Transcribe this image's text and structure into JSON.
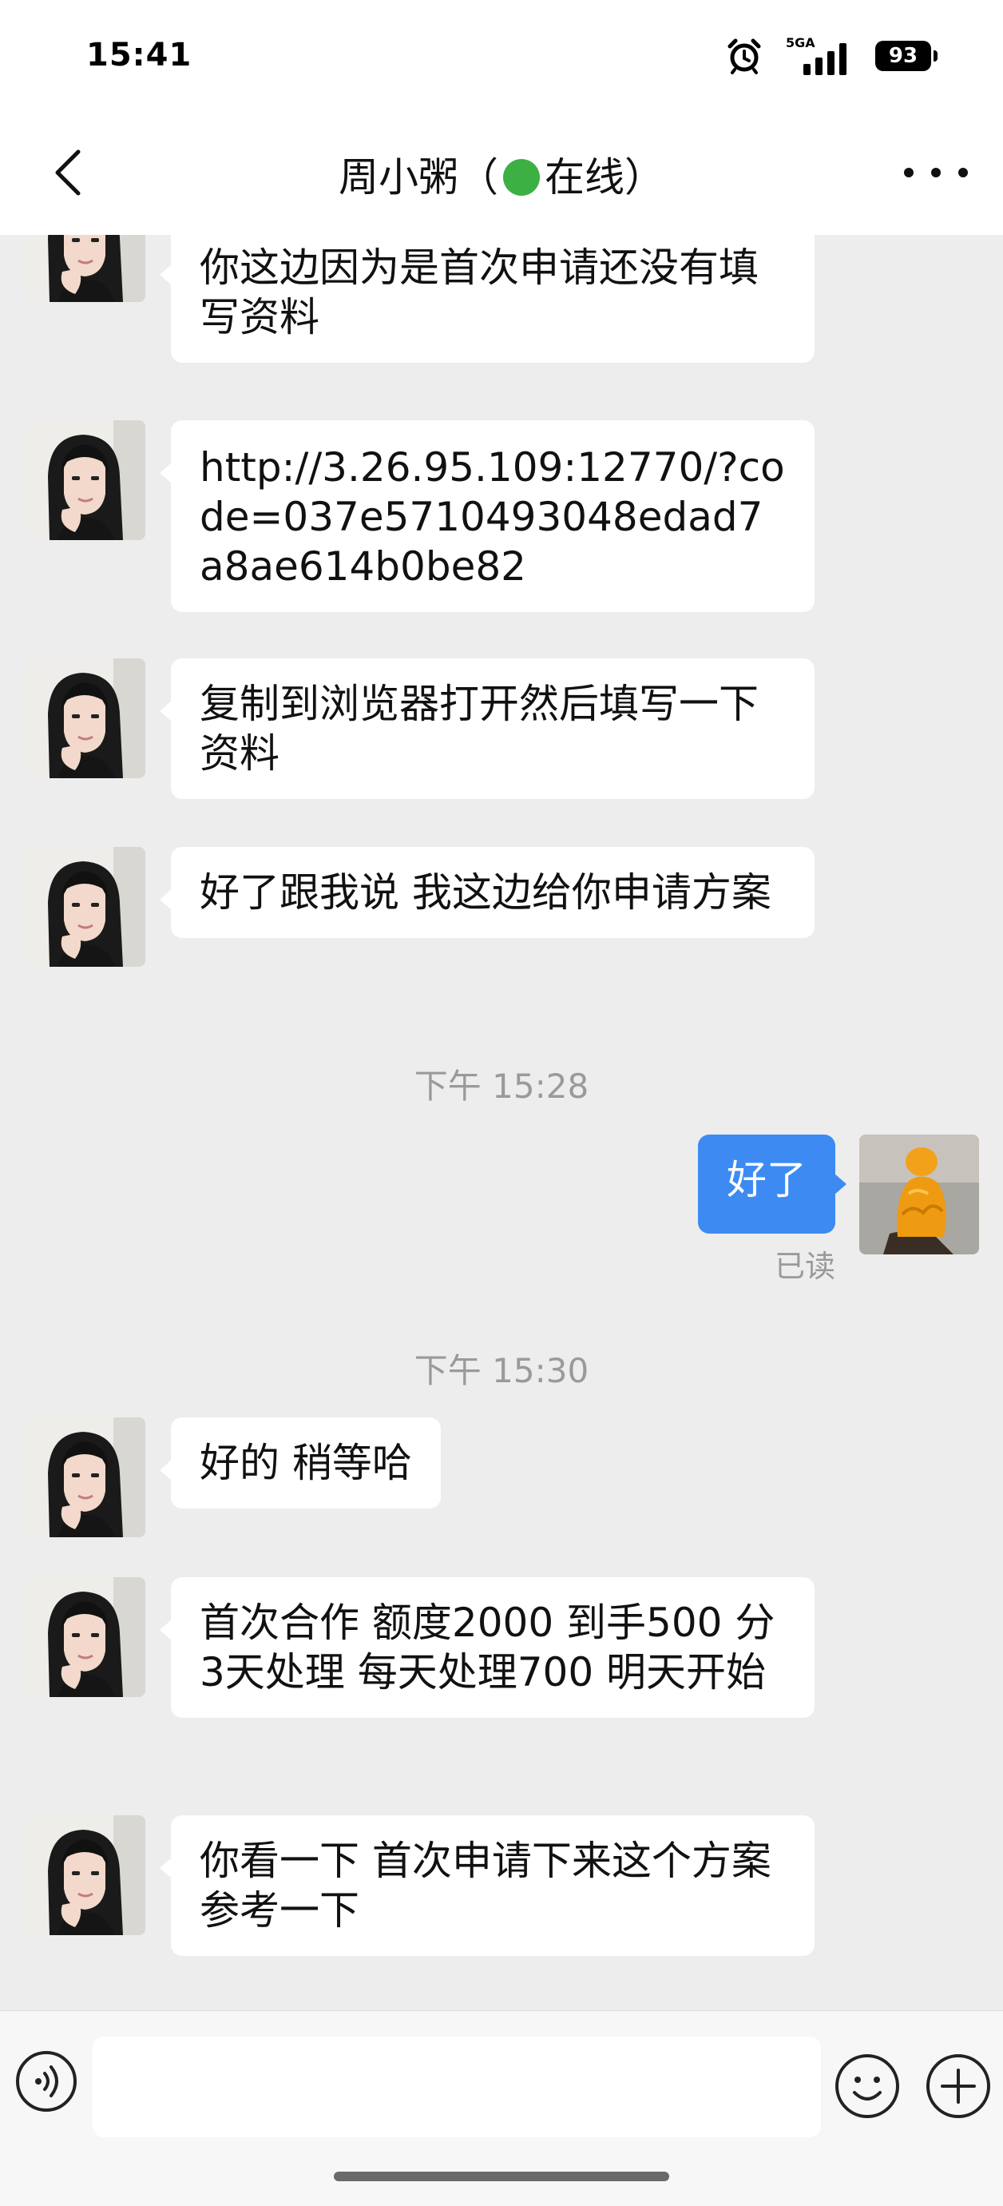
{
  "status_bar": {
    "time": "15:41",
    "network": "5GA",
    "battery": "93",
    "icons": [
      "alarm-icon",
      "signal-icon",
      "battery-icon"
    ]
  },
  "header": {
    "title_prefix": "周小粥（",
    "title_suffix": "在线）",
    "status_color": "#3CB043",
    "icons": [
      "back-arrow-icon",
      "more-icon"
    ]
  },
  "messages": [
    {
      "sender": "contact",
      "text": "你这边因为是首次申请还没有填写资料"
    },
    {
      "sender": "contact",
      "text": "http://3.26.95.109:12770/?code=037e5710493048edad7a8ae614b0be82"
    },
    {
      "sender": "contact",
      "text": "复制到浏览器打开然后填写一下资料"
    },
    {
      "sender": "contact",
      "text": "好了跟我说 我这边给你申请方案"
    },
    {
      "type": "timestamp",
      "text": "下午 15:28"
    },
    {
      "sender": "self",
      "text": "好了",
      "status": "已读"
    },
    {
      "type": "timestamp",
      "text": "下午 15:30"
    },
    {
      "sender": "contact",
      "text": "好的 稍等哈"
    },
    {
      "sender": "contact",
      "text": "首次合作 额度2000 到手500 分3天处理 每天处理700 明天开始"
    },
    {
      "sender": "contact",
      "text": "你看一下 首次申请下来这个方案 参考一下"
    }
  ],
  "input_bar": {
    "value": "",
    "icons": [
      "voice-icon",
      "emoji-icon",
      "plus-icon"
    ]
  },
  "colors": {
    "self_bubble": "#3D8BF2",
    "chat_background": "#EDEDED"
  }
}
